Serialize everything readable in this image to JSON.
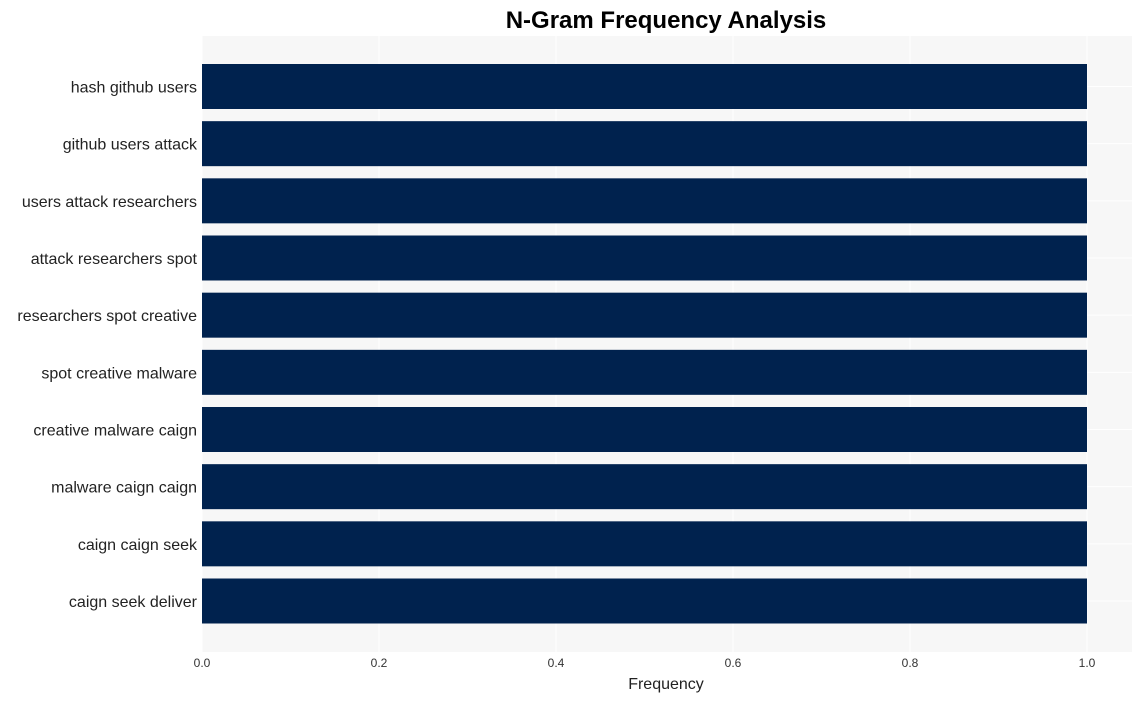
{
  "chart_data": {
    "type": "bar",
    "orientation": "horizontal",
    "title": "N-Gram Frequency Analysis",
    "xlabel": "Frequency",
    "ylabel": "",
    "categories": [
      "hash github users",
      "github users attack",
      "users attack researchers",
      "attack researchers spot",
      "researchers spot creative",
      "spot creative malware",
      "creative malware caign",
      "malware caign caign",
      "caign caign seek",
      "caign seek deliver"
    ],
    "values": [
      1,
      1,
      1,
      1,
      1,
      1,
      1,
      1,
      1,
      1
    ],
    "xlim": [
      0,
      1.05
    ],
    "xticks": [
      0.0,
      0.2,
      0.4,
      0.6,
      0.8,
      1.0
    ],
    "xtick_labels": [
      "0.0",
      "0.2",
      "0.4",
      "0.6",
      "0.8",
      "1.0"
    ],
    "grid": true,
    "legend": "none",
    "colors": {
      "bar": "#00224e",
      "plot_background": "#f7f7f7",
      "grid": "#ffffff"
    }
  }
}
